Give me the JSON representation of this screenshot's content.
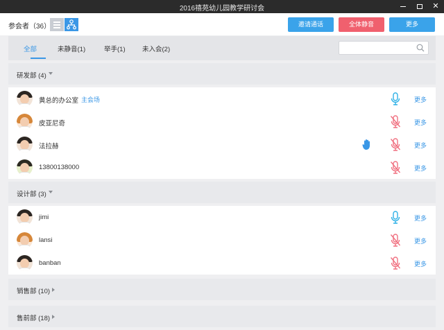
{
  "window": {
    "title": "2016禧苑幼儿园教学研讨会"
  },
  "toolbar": {
    "participants_label": "参会者（36）",
    "invite_label": "邀请通话",
    "mute_all_label": "全体静音",
    "more_label": "更多"
  },
  "tabs": [
    {
      "label": "全部",
      "active": true
    },
    {
      "label": "未静音(1)"
    },
    {
      "label": "举手(1)"
    },
    {
      "label": "未入会(2)"
    }
  ],
  "search": {
    "placeholder": "",
    "icon": "search-icon"
  },
  "colors": {
    "accent": "#3a97e6",
    "danger": "#f0606e",
    "mic_on": "#2fb1e6",
    "mic_off": "#f07080",
    "hand": "#3a97e6"
  },
  "groups": [
    {
      "label": "研发部 (4)",
      "expanded": true,
      "members": [
        {
          "name": "黄总的办公室",
          "tag": "主会场",
          "mic": "on",
          "more": "更多"
        },
        {
          "name": "皮亚尼奇",
          "mic": "off",
          "more": "更多"
        },
        {
          "name": "法拉赫",
          "hand_raised": true,
          "mic": "off",
          "more": "更多"
        },
        {
          "name": "13800138000",
          "mic": "off",
          "more": "更多"
        }
      ]
    },
    {
      "label": "设计部 (3)",
      "expanded": true,
      "members": [
        {
          "name": "jimi",
          "mic": "on",
          "more": "更多"
        },
        {
          "name": "lansi",
          "mic": "off",
          "more": "更多"
        },
        {
          "name": "banban",
          "mic": "off",
          "more": "更多"
        }
      ]
    },
    {
      "label": "销售部 (10)",
      "expanded": false
    },
    {
      "label": "售前部 (18)",
      "expanded": false
    }
  ]
}
